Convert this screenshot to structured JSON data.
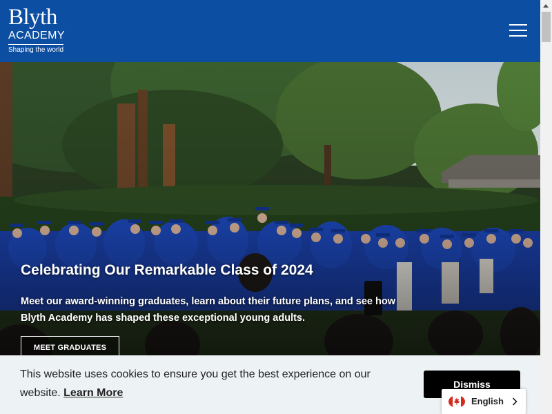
{
  "header": {
    "logo_main": "Blyth",
    "logo_sub": "ACADEMY",
    "logo_tagline": "Shaping the world",
    "menu_icon": "hamburger-menu-icon",
    "background_color": "#0b4ea2"
  },
  "hero": {
    "title": "Celebrating Our Remarkable Class of 2024",
    "description": "Meet our award-winning graduates, learn about their future plans, and see how Blyth Academy has shaped these exceptional young adults.",
    "button_label": "MEET GRADUATES",
    "gown_color": "#1a3fa8"
  },
  "cookie_banner": {
    "text": "This website uses cookies to ensure you get the best experience on our website.",
    "link_label": "Learn More",
    "dismiss_label": "Dismiss",
    "background_color": "#edf2f4"
  },
  "language_selector": {
    "selected": "English",
    "flag_icon": "canada-flag-icon",
    "chevron_icon": "chevron-right-icon"
  }
}
